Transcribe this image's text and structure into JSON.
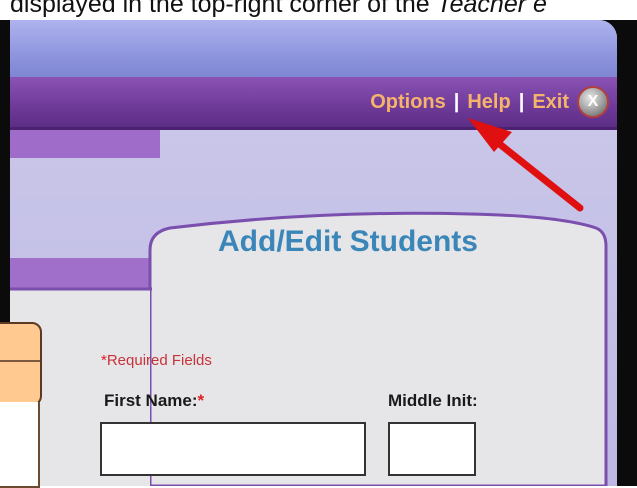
{
  "caption": {
    "prefix": "displayed in the top-right corner of the ",
    "italic": "Teacher e"
  },
  "menu": {
    "options_label": "Options",
    "help_label": "Help",
    "exit_label": "Exit",
    "separator": "|",
    "close_glyph": "X"
  },
  "panel": {
    "title": "Add/Edit Students"
  },
  "form": {
    "required_star": "*",
    "required_text": "Required Fields",
    "first_name_label": "First Name:",
    "first_name_star": "*",
    "first_name_value": "",
    "middle_init_label": "Middle Init:",
    "middle_init_value": ""
  },
  "colors": {
    "menu_text": "#f5b46a",
    "menubar": "#6e3a98",
    "title_text": "#3a86b8",
    "required": "#c8323a",
    "arrow": "#e01010"
  }
}
